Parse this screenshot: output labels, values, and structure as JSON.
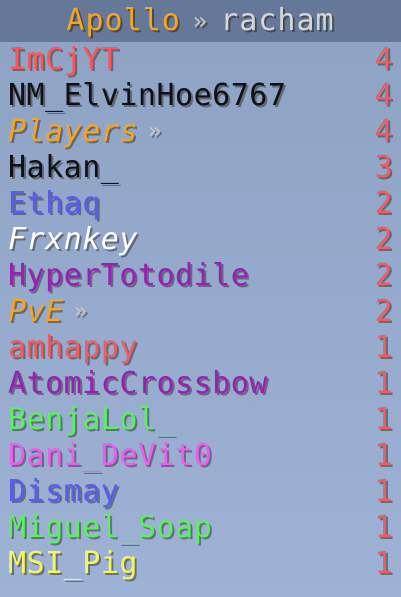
{
  "header": {
    "server": "Apollo",
    "separator": "»",
    "subtitle": "racham"
  },
  "entries": [
    {
      "name": "ImCjYT",
      "score": "4",
      "color": "#ff5555",
      "italic": false,
      "chevron": false
    },
    {
      "name": "NM_ElvinHoe6767",
      "score": "4",
      "color": "#111111",
      "italic": false,
      "chevron": false
    },
    {
      "name": "Players",
      "score": "4",
      "color": "#f7a41e",
      "italic": true,
      "chevron": true,
      "chevron_text": "»"
    },
    {
      "name": "Hakan_",
      "score": "3",
      "color": "#111111",
      "italic": false,
      "chevron": false
    },
    {
      "name": "Ethaq",
      "score": "2",
      "color": "#5a5cf0",
      "italic": false,
      "chevron": false
    },
    {
      "name": "Frxnkey",
      "score": "2",
      "color": "#ffffff",
      "italic": true,
      "chevron": false
    },
    {
      "name": "HyperTotodile",
      "score": "2",
      "color": "#9b1fb0",
      "italic": false,
      "chevron": false
    },
    {
      "name": "PvE",
      "score": "2",
      "color": "#f7a41e",
      "italic": true,
      "chevron": true,
      "chevron_text": "»"
    },
    {
      "name": "amhappy",
      "score": "1",
      "color": "#f25c5c",
      "italic": false,
      "chevron": false
    },
    {
      "name": "AtomicCrossbow",
      "score": "1",
      "color": "#9b1fb0",
      "italic": false,
      "chevron": false
    },
    {
      "name": "BenjaLol_",
      "score": "1",
      "color": "#5cf05c",
      "italic": false,
      "chevron": false
    },
    {
      "name": "Dani_DeVit0",
      "score": "1",
      "color": "#f05cf0",
      "italic": false,
      "chevron": false
    },
    {
      "name": "Dismay",
      "score": "1",
      "color": "#5a5cf0",
      "italic": false,
      "chevron": false
    },
    {
      "name": "Miguel_Soap",
      "score": "1",
      "color": "#5cf05c",
      "italic": false,
      "chevron": false
    },
    {
      "name": "MSI_Pig",
      "score": "1",
      "color": "#f5f55c",
      "italic": false,
      "chevron": false
    }
  ],
  "colors": {
    "score": "#f25c5c",
    "header_server": "#f7a41e",
    "header_subtitle": "#d6d6d6"
  }
}
